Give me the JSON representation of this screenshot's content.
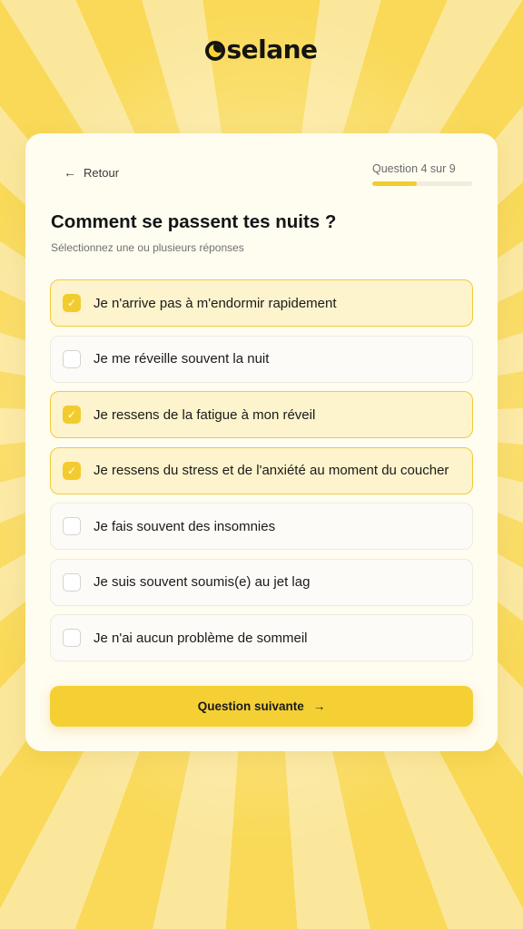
{
  "brand": {
    "name": "Oselane",
    "logo_rest": "selane"
  },
  "header": {
    "back_label": "Retour",
    "back_icon": "arrow-left-icon",
    "progress_label": "Question 4 sur 9",
    "progress_fraction": 0.444
  },
  "question": {
    "title": "Comment se passent tes nuits ?",
    "subtitle": "Sélectionnez une ou plusieurs réponses"
  },
  "options": [
    {
      "label": "Je n'arrive pas à m'endormir rapidement",
      "checked": true
    },
    {
      "label": "Je me réveille souvent la nuit",
      "checked": false
    },
    {
      "label": "Je ressens de la fatigue à mon réveil",
      "checked": true
    },
    {
      "label": "Je ressens du stress et de l'anxiété au moment du coucher",
      "checked": true
    },
    {
      "label": "Je fais souvent des insomnies",
      "checked": false
    },
    {
      "label": "Je suis souvent soumis(e) au jet lag",
      "checked": false
    },
    {
      "label": "Je n'ai aucun problème de sommeil",
      "checked": false
    }
  ],
  "next_button": {
    "label": "Question suivante",
    "icon": "arrow-right-icon"
  },
  "colors": {
    "accent": "#f2cc2e",
    "selected_bg": "#fdf3cc",
    "text": "#141414"
  }
}
